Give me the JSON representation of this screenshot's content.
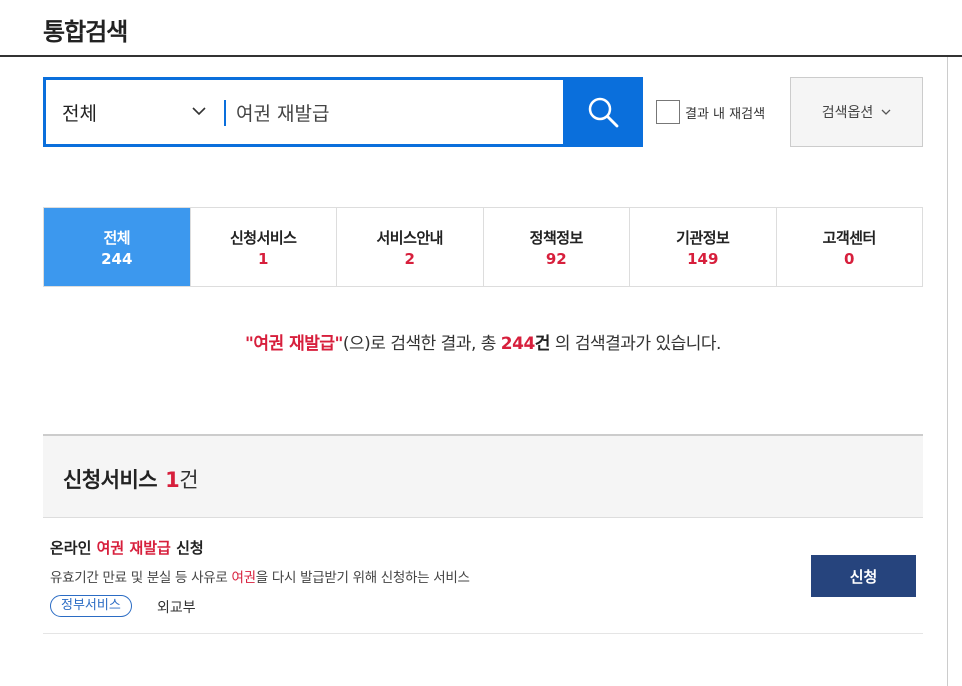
{
  "page_title": "통합검색",
  "search": {
    "scope_value": "전체",
    "query_value": "여권 재발급",
    "button_icon": "search-icon",
    "refine_label": "결과 내 재검색",
    "options_label": "검색옵션"
  },
  "tabs": [
    {
      "label": "전체",
      "count": "244",
      "active": true
    },
    {
      "label": "신청서비스",
      "count": "1"
    },
    {
      "label": "서비스안내",
      "count": "2"
    },
    {
      "label": "정책정보",
      "count": "92"
    },
    {
      "label": "기관정보",
      "count": "149"
    },
    {
      "label": "고객센터",
      "count": "0"
    }
  ],
  "summary": {
    "keyword": "\"여권 재발급\"",
    "middle": "(으)로 검색한 결과, 총 ",
    "count": "244",
    "unit": "건",
    "tail": " 의 검색결과가 있습니다."
  },
  "section": {
    "title": "신청서비스",
    "count": "1",
    "unit": "건"
  },
  "result": {
    "title_pre": "온라인 ",
    "title_hl": "여권 재발급",
    "title_post": " 신청",
    "desc_pre": "유효기간 만료 및 분실 등 사유로 ",
    "desc_hl": "여권",
    "desc_post": "을 다시 발급받기 위해 신청하는 서비스",
    "badge": "정부서비스",
    "org": "외교부",
    "apply_label": "신청"
  },
  "colors": {
    "primary_blue": "#0a6fdc",
    "active_tab": "#3c98ee",
    "highlight_red": "#d71f3c",
    "apply_navy": "#26447d"
  }
}
